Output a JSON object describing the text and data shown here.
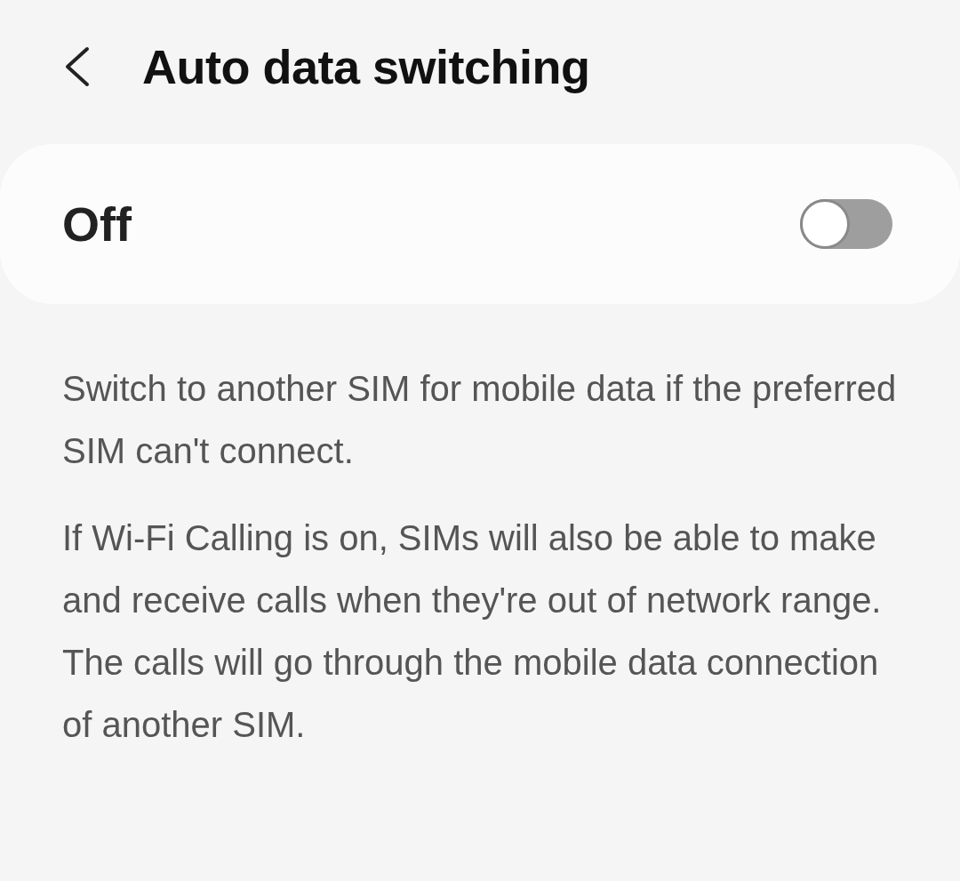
{
  "header": {
    "title": "Auto data switching"
  },
  "main_switch": {
    "label": "Off",
    "on": false
  },
  "description": [
    "Switch to another SIM for mobile data if the preferred SIM can't connect.",
    "If Wi-Fi Calling is on, SIMs will also be able to make and receive calls when they're out of network range. The calls will go through the mobile data connection of another SIM."
  ]
}
